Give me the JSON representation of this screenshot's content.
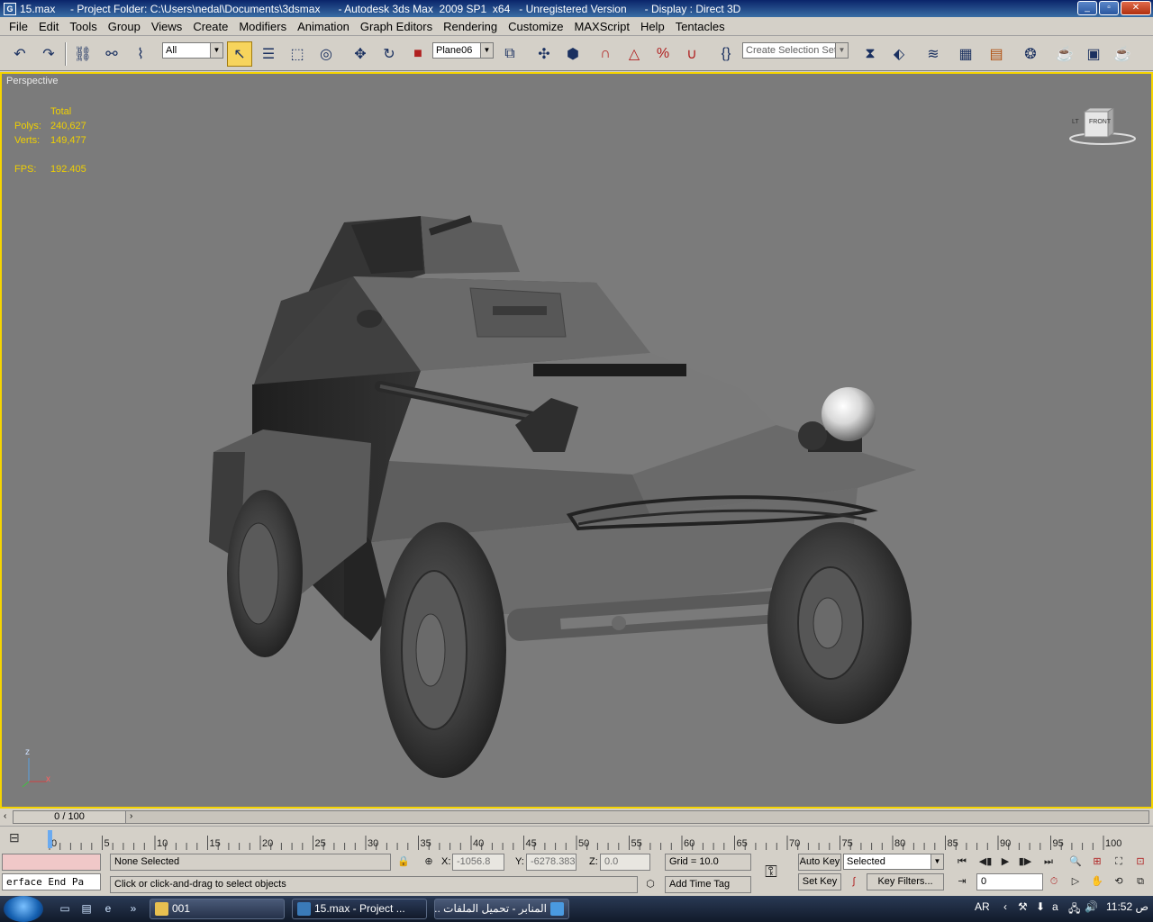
{
  "window": {
    "title": "15.max     - Project Folder: C:\\Users\\nedal\\Documents\\3dsmax      - Autodesk 3ds Max  2009 SP1  x64   - Unregistered Version      - Display : Direct 3D"
  },
  "menu": [
    "File",
    "Edit",
    "Tools",
    "Group",
    "Views",
    "Create",
    "Modifiers",
    "Animation",
    "Graph Editors",
    "Rendering",
    "Customize",
    "MAXScript",
    "Help",
    "Tentacles"
  ],
  "toolbar": {
    "selection_filter": "All",
    "reference_coord": "Plane06",
    "named_selection_placeholder": "Create Selection Set"
  },
  "viewport": {
    "label": "Perspective",
    "stats": {
      "header": "Total",
      "polys_label": "Polys:",
      "polys": "240,627",
      "verts_label": "Verts:",
      "verts": "149,477",
      "fps_label": "FPS:",
      "fps": "192.405"
    },
    "viewcube_face": "FRONT",
    "viewcube_side": "LT",
    "axis_x": "x",
    "axis_z": "z"
  },
  "timeline": {
    "position": "0 / 100",
    "ticks": [
      "0",
      "5",
      "10",
      "15",
      "20",
      "25",
      "30",
      "35",
      "40",
      "45",
      "50",
      "55",
      "60",
      "65",
      "70",
      "75",
      "80",
      "85",
      "90",
      "95",
      "100"
    ]
  },
  "status": {
    "maxscript_listener": "erface End Pa",
    "selection": "None Selected",
    "prompt": "Click or click-and-drag to select objects",
    "x_label": "X:",
    "x": "-1056.8",
    "y_label": "Y:",
    "y": "-6278.383",
    "z_label": "Z:",
    "z": "0.0",
    "grid": "Grid = 10.0",
    "add_time_tag": "Add Time Tag",
    "auto_key": "Auto Key",
    "set_key": "Set Key",
    "key_mode": "Selected",
    "key_filters": "Key Filters...",
    "current_frame": "0"
  },
  "taskbar": {
    "tasks": [
      "001",
      "15.max     - Project ...",
      "المنابر - تحميل الملفات ..."
    ],
    "language": "AR",
    "clock": "11:52 ص"
  },
  "colors": {
    "viewport_bg": "#7b7b7b",
    "viewport_border": "#f5d400",
    "stats_text": "#f0d000"
  }
}
